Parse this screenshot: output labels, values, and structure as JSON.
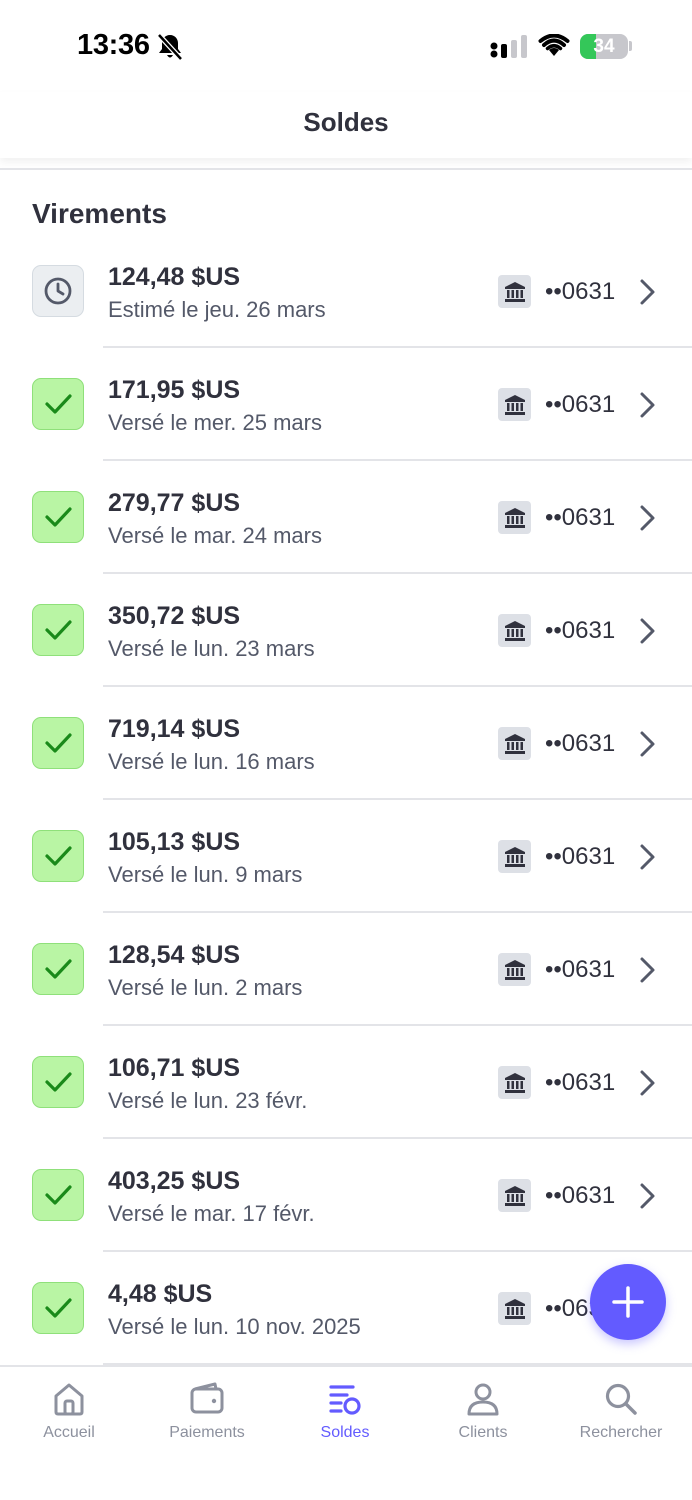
{
  "status_bar": {
    "time": "13:36",
    "battery": "34",
    "battery_level": 0.34
  },
  "header": {
    "title": "Soldes"
  },
  "section": {
    "title": "Virements"
  },
  "payouts": [
    {
      "amount": "124,48 $US",
      "date": "Estimé le jeu. 26 mars",
      "account": "••0631",
      "status": "pending"
    },
    {
      "amount": "171,95 $US",
      "date": "Versé le mer. 25 mars",
      "account": "••0631",
      "status": "paid"
    },
    {
      "amount": "279,77 $US",
      "date": "Versé le mar. 24 mars",
      "account": "••0631",
      "status": "paid"
    },
    {
      "amount": "350,72 $US",
      "date": "Versé le lun. 23 mars",
      "account": "••0631",
      "status": "paid"
    },
    {
      "amount": "719,14 $US",
      "date": "Versé le lun. 16 mars",
      "account": "••0631",
      "status": "paid"
    },
    {
      "amount": "105,13 $US",
      "date": "Versé le lun. 9 mars",
      "account": "••0631",
      "status": "paid"
    },
    {
      "amount": "128,54 $US",
      "date": "Versé le lun. 2 mars",
      "account": "••0631",
      "status": "paid"
    },
    {
      "amount": "106,71 $US",
      "date": "Versé le lun. 23 févr.",
      "account": "••0631",
      "status": "paid"
    },
    {
      "amount": "403,25 $US",
      "date": "Versé le mar. 17 févr.",
      "account": "••0631",
      "status": "paid"
    },
    {
      "amount": "4,48 $US",
      "date": "Versé le lun. 10 nov. 2025",
      "account": "••0631",
      "status": "paid"
    }
  ],
  "tabs": [
    {
      "label": "Accueil",
      "icon": "home-icon"
    },
    {
      "label": "Paiements",
      "icon": "wallet-icon"
    },
    {
      "label": "Soldes",
      "icon": "balances-icon",
      "active": true
    },
    {
      "label": "Clients",
      "icon": "person-icon"
    },
    {
      "label": "Rechercher",
      "icon": "search-icon"
    }
  ],
  "colors": {
    "accent": "#635bff",
    "paid_bg": "#b9f5a4",
    "paid_check": "#1a8a1a",
    "pending_bg": "#ebeef1",
    "text_primary": "#30313d",
    "text_secondary": "#545969",
    "tab_inactive": "#8d919e"
  }
}
